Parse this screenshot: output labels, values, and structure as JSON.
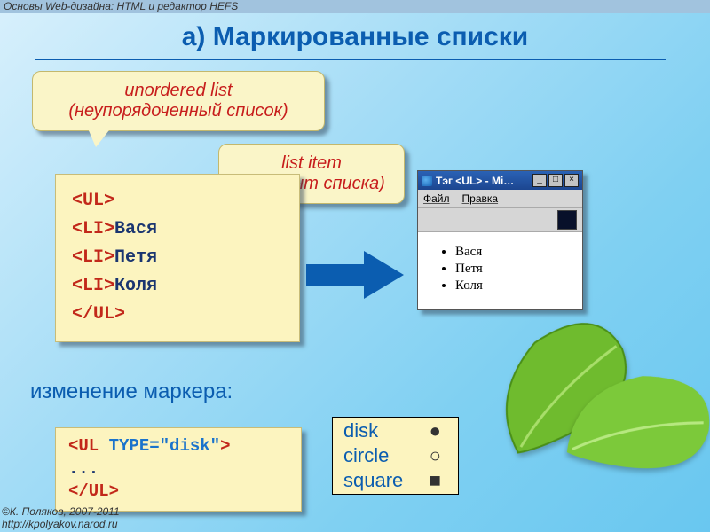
{
  "header": "Основы Web-дизайна: HTML и редактор HEFS",
  "title": "а) Маркированные списки",
  "callout1": {
    "line1": "unordered list",
    "line2": "(неупорядоченный список)"
  },
  "callout2": {
    "line1": "list item",
    "line2": "(элемент списка)"
  },
  "code": {
    "open": "<UL>",
    "li": "<LI>",
    "names": [
      "Вася",
      "Петя",
      "Коля"
    ],
    "close": "</UL>"
  },
  "browser": {
    "title": "Тэг <UL> - Mi…",
    "menu": [
      "Файл",
      "Правка"
    ],
    "items": [
      "Вася",
      "Петя",
      "Коля"
    ]
  },
  "marker_label": "изменение маркера:",
  "code2": {
    "open": "<UL",
    "attr": " TYPE=",
    "val": "\"disk\"",
    "gt": ">",
    "dots": "...",
    "close": "</UL>"
  },
  "types": [
    {
      "name": "disk",
      "sym": "●"
    },
    {
      "name": "circle",
      "sym": "○"
    },
    {
      "name": "square",
      "sym": "■"
    }
  ],
  "footer": {
    "line1": "©К. Поляков, 2007-2011",
    "line2": "http://kpolyakov.narod.ru"
  }
}
